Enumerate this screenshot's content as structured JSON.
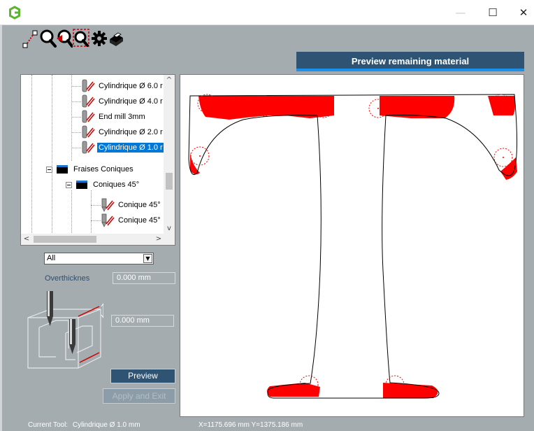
{
  "window": {
    "logo_icon": "app-logo-icon",
    "minimize_glyph": "—",
    "maximize_glyph": "☐",
    "close_glyph": "✕"
  },
  "toolbar": {
    "icons": [
      "measure-icon",
      "zoom-in-icon",
      "zoom-out-icon",
      "zoom-window-icon",
      "settings-gear-icon",
      "print-icon"
    ]
  },
  "tab": {
    "label": "Preview remaining material"
  },
  "tree": {
    "items": [
      {
        "label": "Cylindrique Ø 6.0 r",
        "icon": "cylindrical-mill-icon",
        "selected": false
      },
      {
        "label": "Cylindrique Ø 4.0 r",
        "icon": "cylindrical-mill-icon",
        "selected": false
      },
      {
        "label": "End mill 3mm",
        "icon": "cylindrical-mill-icon",
        "selected": false
      },
      {
        "label": "Cylindrique Ø 2.0 r",
        "icon": "cylindrical-mill-icon",
        "selected": false
      },
      {
        "label": "Cylindrique Ø 1.0 r",
        "icon": "cylindrical-mill-icon",
        "selected": true
      },
      {
        "label": "Fraises Coniques",
        "icon": "folder-icon",
        "selected": false
      },
      {
        "label": "Coniques 45°",
        "icon": "folder-icon",
        "selected": false
      },
      {
        "label": "Conique 45°",
        "icon": "conical-mill-icon",
        "selected": false
      },
      {
        "label": "Conique 45°",
        "icon": "conical-mill-icon",
        "selected": false
      }
    ],
    "scroll_up": "^",
    "scroll_down": "v",
    "scroll_left": "<",
    "scroll_right": ">"
  },
  "filter": {
    "value": "All",
    "drop_glyph": "▼"
  },
  "overthickness": {
    "label": "Overthicknes",
    "value": "0.000 mm"
  },
  "depth": {
    "value": "0.000 mm"
  },
  "buttons": {
    "preview": "Preview",
    "apply_exit": "Apply and Exit"
  },
  "status": {
    "current_tool_label": "Current Tool:",
    "current_tool_value": "Cylindrique Ø 1.0 mm",
    "coords": "X=1175.696 mm Y=1375.186 mm"
  },
  "colors": {
    "accent": "#2f5372",
    "tab_underline": "#1e90e8",
    "remaining_material": "#ff0000",
    "background": "#a5acaf"
  }
}
